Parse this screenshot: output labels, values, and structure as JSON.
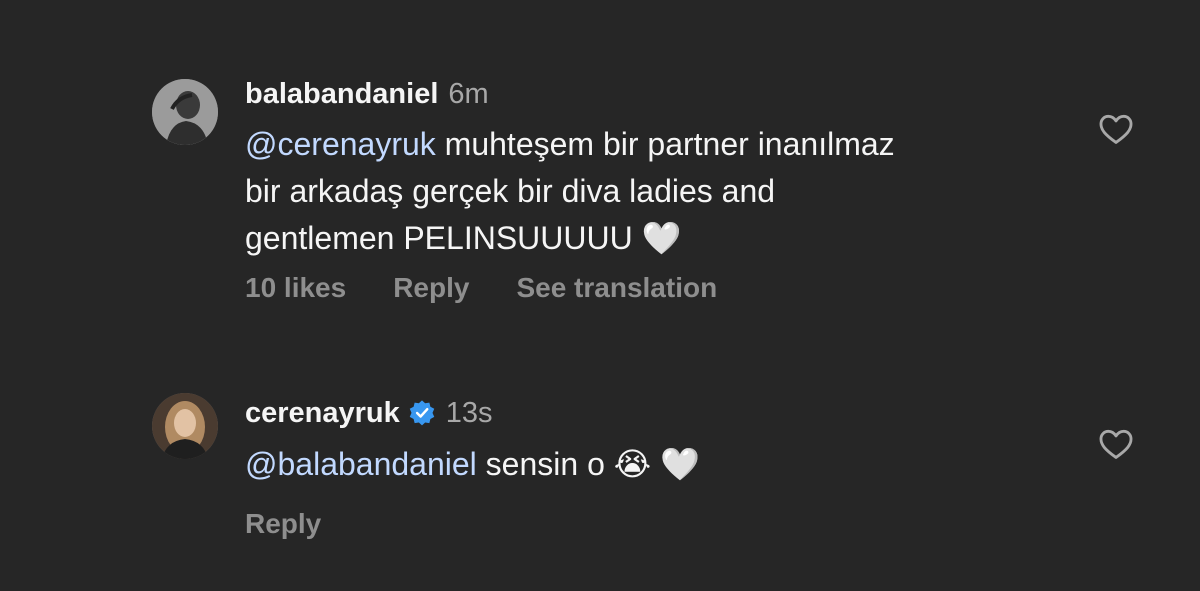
{
  "comments": [
    {
      "username": "balabandaniel",
      "time": "6m",
      "mention": "@cerenayruk",
      "text_line1": "muhteşem bir partner inanılmaz",
      "text_line2": "bir arkadaş gerçek bir diva ladies and",
      "text_line3": "gentlemen PELINSUUUUU",
      "emoji_heart": "🤍",
      "likes": "10 likes",
      "reply": "Reply",
      "see_translation": "See translation",
      "like_icon": "heart-outline-icon"
    },
    {
      "username": "cerenayruk",
      "verified": true,
      "time": "13s",
      "mention": "@balabandaniel",
      "text": "sensin o",
      "emoji_cry": "😭",
      "emoji_heart": "🤍",
      "reply": "Reply",
      "like_icon": "heart-outline-icon"
    }
  ],
  "colors": {
    "background": "#262626",
    "primary_text": "#f5f5f5",
    "secondary_text": "#a8a8a8",
    "action_text": "#8e8e8e",
    "mention": "#c2d9ff",
    "verified_badge": "#3897f0"
  }
}
